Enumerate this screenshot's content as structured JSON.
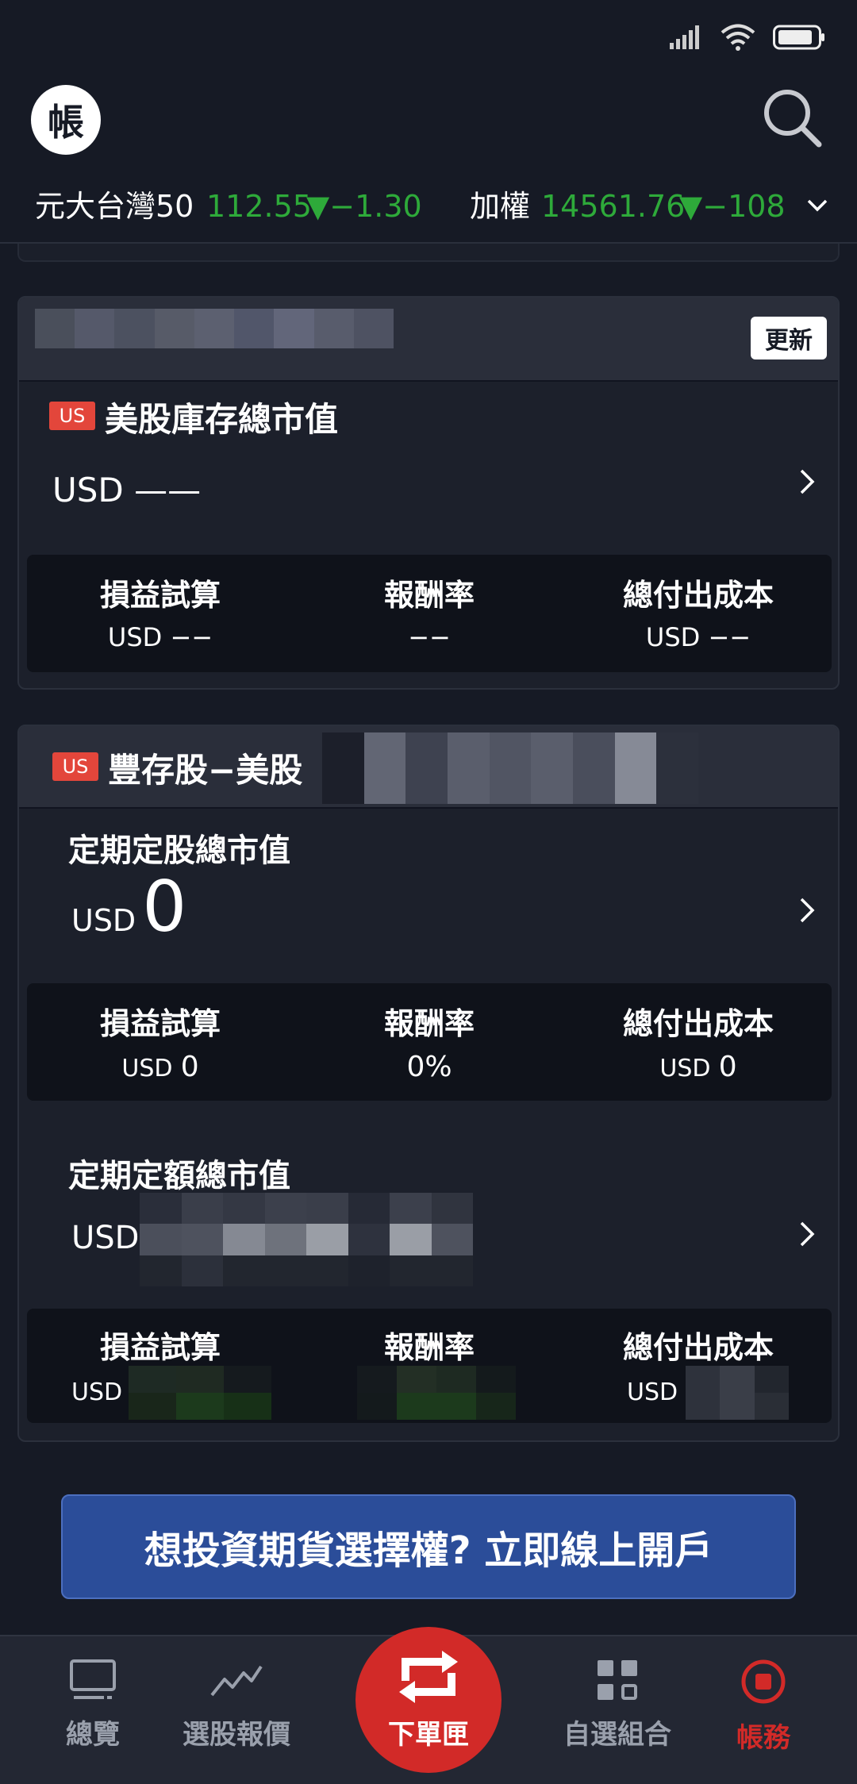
{
  "header": {
    "avatar_label": "帳"
  },
  "ticker": {
    "item1_name": "元大台灣50",
    "item1_price": "112.55",
    "item1_change": "▼−1.30",
    "item2_name": "加權",
    "item2_price": "14561.76",
    "item2_change": "▼−108"
  },
  "card1": {
    "refresh_label": "更新",
    "badge": "US",
    "title": "美股庫存總市值",
    "value": "USD ——",
    "stats": [
      {
        "label": "損益試算",
        "value": "USD −−"
      },
      {
        "label": "報酬率",
        "value": "−−"
      },
      {
        "label": "總付出成本",
        "value": "USD −−"
      }
    ]
  },
  "card2": {
    "badge": "US",
    "title": "豐存股−美股",
    "section1": {
      "title": "定期定股總市值",
      "currency": "USD",
      "value": "0",
      "stats": [
        {
          "label": "損益試算",
          "currency": "USD",
          "value": "0"
        },
        {
          "label": "報酬率",
          "value": "0%"
        },
        {
          "label": "總付出成本",
          "currency": "USD",
          "value": "0"
        }
      ]
    },
    "section2": {
      "title": "定期定額總市值",
      "currency": "USD",
      "stats": [
        {
          "label": "損益試算",
          "currency": "USD"
        },
        {
          "label": "報酬率"
        },
        {
          "label": "總付出成本",
          "currency": "USD"
        }
      ]
    }
  },
  "banner": {
    "text": "想投資期貨選擇權? 立即線上開戶"
  },
  "nav": {
    "overview": "總覽",
    "quotes": "選股報價",
    "order": "下單匣",
    "watchlist": "自選組合",
    "account": "帳務"
  },
  "colors": {
    "accent_red": "#d22a28",
    "up_green": "#2eaa3a",
    "banner_blue": "#2b4d99"
  }
}
